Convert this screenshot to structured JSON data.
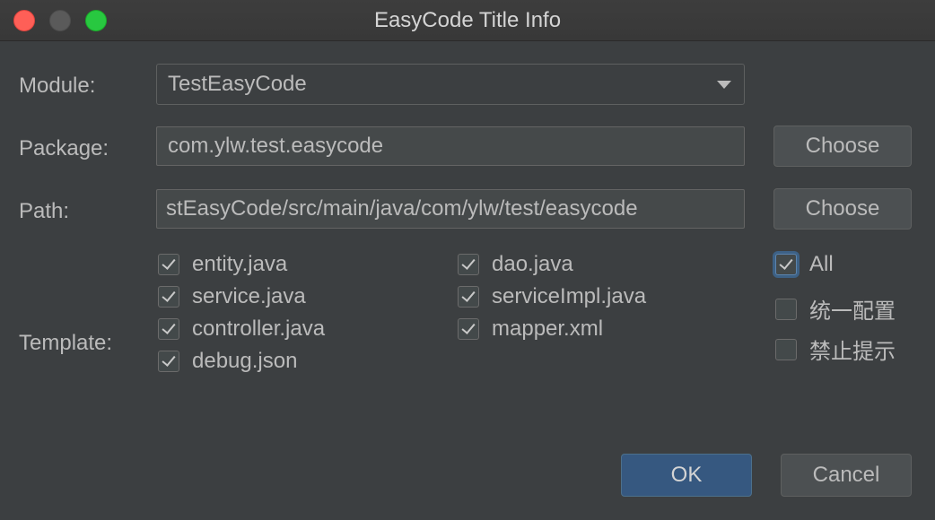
{
  "window": {
    "title": "EasyCode Title Info"
  },
  "form": {
    "module_label": "Module:",
    "module_value": "TestEasyCode",
    "package_label": "Package:",
    "package_value": "com.ylw.test.easycode",
    "path_label": "Path:",
    "path_value": "stEasyCode/src/main/java/com/ylw/test/easycode",
    "template_label": "Template:",
    "choose_label": "Choose"
  },
  "templates": [
    {
      "label": "entity.java",
      "checked": true
    },
    {
      "label": "service.java",
      "checked": true
    },
    {
      "label": "controller.java",
      "checked": true
    },
    {
      "label": "debug.json",
      "checked": true
    },
    {
      "label": "dao.java",
      "checked": true
    },
    {
      "label": "serviceImpl.java",
      "checked": true
    },
    {
      "label": "mapper.xml",
      "checked": true
    }
  ],
  "options": [
    {
      "label": "All",
      "checked": true
    },
    {
      "label": "统一配置",
      "checked": false
    },
    {
      "label": "禁止提示",
      "checked": false
    }
  ],
  "buttons": {
    "ok": "OK",
    "cancel": "Cancel"
  }
}
